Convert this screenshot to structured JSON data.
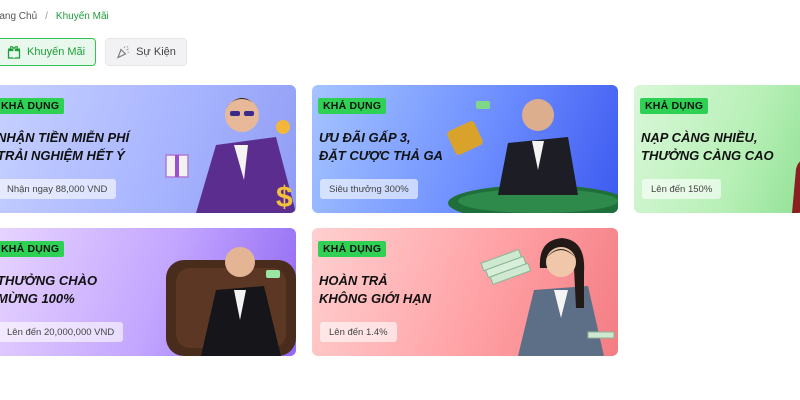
{
  "breadcrumb": {
    "home": "rang Chủ",
    "separator": "/",
    "current": "Khuyến Mãi"
  },
  "tabs": [
    {
      "label": "Khuyến Mãi",
      "icon": "gift-icon",
      "active": true
    },
    {
      "label": "Sự Kiện",
      "icon": "party-popper-icon",
      "active": false
    }
  ],
  "colors": {
    "accent": "#1e9e3a",
    "badge": "#2fd154"
  },
  "promotions": [
    {
      "badge": "KHẢ DỤNG",
      "title": "NHẬN TIỀN MIỄN PHÍ\nTRẢI NGHIỆM HẾT Ý",
      "subtitle": "Nhận ngay 88,000 VND"
    },
    {
      "badge": "KHẢ DỤNG",
      "title": "ƯU ĐÃI GẤP 3,\nĐẶT CƯỢC THẢ GA",
      "subtitle": "Siêu thưởng 300%"
    },
    {
      "badge": "KHẢ DỤNG",
      "title": "NẠP CÀNG NHIỀU,\nTHƯỞNG CÀNG CAO",
      "subtitle": "Lên đến 150%"
    },
    {
      "badge": "KHẢ DỤNG",
      "title": "THƯỞNG CHÀO\nMỪNG 100%",
      "subtitle": "Lên đến 20,000,000 VND"
    },
    {
      "badge": "KHẢ DỤNG",
      "title": "HOÀN TRẢ\nKHÔNG GIỚI HẠN",
      "subtitle": "Lên đến 1.4%"
    }
  ]
}
